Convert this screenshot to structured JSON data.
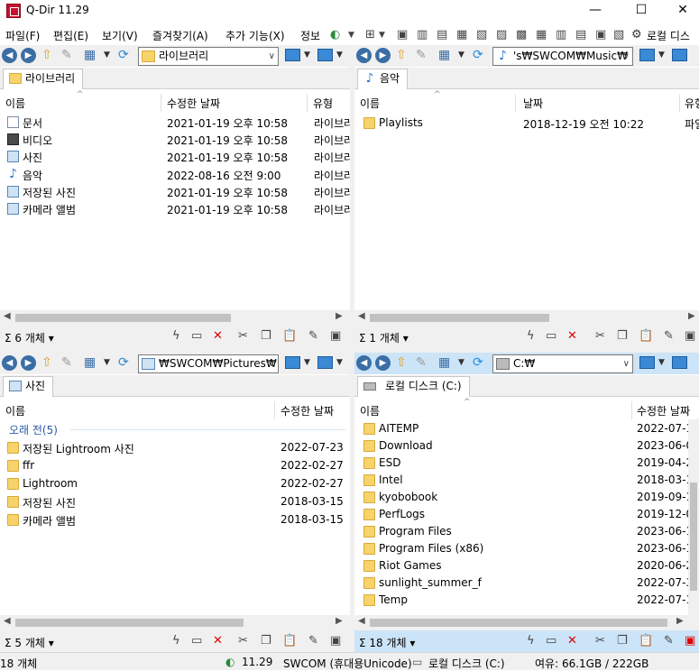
{
  "window": {
    "title": "Q-Dir 11.29",
    "minimize": "—",
    "maximize": "☐",
    "close": "✕"
  },
  "menu": [
    "파일(F)",
    "편집(E)",
    "보기(V)",
    "즐겨찾기(A)",
    "추가 기능(X)",
    "정보"
  ],
  "menu_right": {
    "drive_label": "로컬 디스"
  },
  "panes": {
    "top_left": {
      "path": "라이브러리",
      "tab": "라이브러리",
      "columns": [
        "이름",
        "수정한 날짜",
        "유형"
      ],
      "rows": [
        {
          "name": "문서",
          "date": "2021-01-19 오후 10:58",
          "type": "라이브러",
          "icon": "document-library-icon"
        },
        {
          "name": "비디오",
          "date": "2021-01-19 오후 10:58",
          "type": "라이브러",
          "icon": "video-library-icon"
        },
        {
          "name": "사진",
          "date": "2021-01-19 오후 10:58",
          "type": "라이브러",
          "icon": "picture-library-icon"
        },
        {
          "name": "음악",
          "date": "2022-08-16 오전 9:00",
          "type": "라이브러",
          "icon": "music-library-icon"
        },
        {
          "name": "저장된 사진",
          "date": "2021-01-19 오후 10:58",
          "type": "라이브러",
          "icon": "picture-library-icon"
        },
        {
          "name": "카메라 앨범",
          "date": "2021-01-19 오후 10:58",
          "type": "라이브러",
          "icon": "picture-library-icon"
        }
      ],
      "count": "6 개체"
    },
    "top_right": {
      "path": "'s₩SWCOM₩Music₩",
      "tab": "음악",
      "columns": [
        "이름",
        "날짜",
        "유형"
      ],
      "rows": [
        {
          "name": "Playlists",
          "date": "2018-12-19 오전 10:22",
          "type": "파일"
        }
      ],
      "count": "1 개체"
    },
    "bottom_left": {
      "path": "₩SWCOM₩Pictures₩",
      "tab": "사진",
      "columns": [
        "이름",
        "수정한 날짜"
      ],
      "group": "오래 전(5)",
      "rows": [
        {
          "name": "저장된 Lightroom 사진",
          "date": "2022-07-23"
        },
        {
          "name": "ffr",
          "date": "2022-02-27"
        },
        {
          "name": "Lightroom",
          "date": "2022-02-27"
        },
        {
          "name": "저장된 사진",
          "date": "2018-03-15"
        },
        {
          "name": "카메라 앨범",
          "date": "2018-03-15"
        }
      ],
      "count": "5 개체"
    },
    "bottom_right": {
      "path": "C:₩",
      "tab": "로컬 디스크 (C:)",
      "columns": [
        "이름",
        "수정한 날짜"
      ],
      "rows": [
        {
          "name": "AITEMP",
          "date": "2022-07-1"
        },
        {
          "name": "Download",
          "date": "2023-06-0"
        },
        {
          "name": "ESD",
          "date": "2019-04-2"
        },
        {
          "name": "Intel",
          "date": "2018-03-1"
        },
        {
          "name": "kyobobook",
          "date": "2019-09-1"
        },
        {
          "name": "PerfLogs",
          "date": "2019-12-0"
        },
        {
          "name": "Program Files",
          "date": "2023-06-1"
        },
        {
          "name": "Program Files (x86)",
          "date": "2023-06-1"
        },
        {
          "name": "Riot Games",
          "date": "2020-06-2"
        },
        {
          "name": "sunlight_summer_f",
          "date": "2022-07-3"
        },
        {
          "name": "Temp",
          "date": "2022-07-1"
        }
      ],
      "count": "18 개체"
    }
  },
  "statusbar": {
    "count": "18 개체",
    "version": "11.29",
    "user": "SWCOM (휴대용Unicode)",
    "drive": "로컬 디스크 (C:)",
    "space": "여유: 66.1GB / 222GB"
  }
}
